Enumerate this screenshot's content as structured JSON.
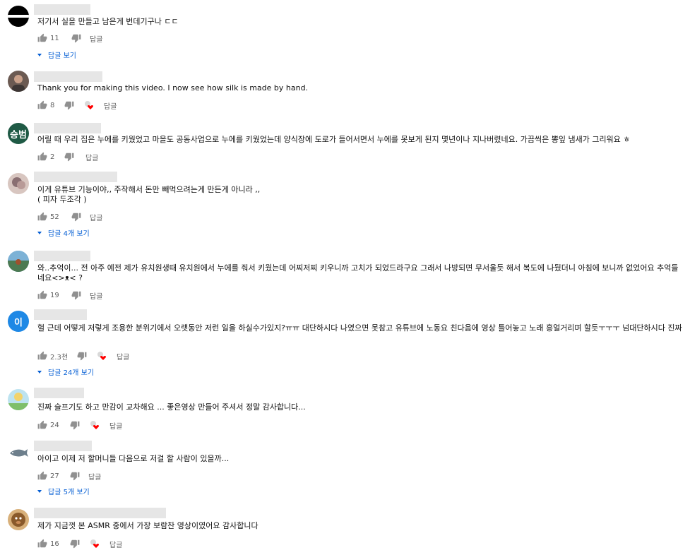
{
  "comments": [
    {
      "text": "저기서 실을 만들고 남은게 번데기구나 ㄷㄷ",
      "likes": "11",
      "reply_label": "답글",
      "replies_label": "답글 보기",
      "avatar_text": ""
    },
    {
      "text": "Thank you for making this video. I now see how silk is made by hand.",
      "likes": "8",
      "reply_label": "답글",
      "avatar_text": ""
    },
    {
      "text": "어릴 때 우리 집은 누에를 키웠었고 마을도 공동사업으로 누에를 키웠었는데 양식장에 도로가 들어서면서 누에를 못보게 된지 몇년이나 지나버렸네요. 가끔씩은 뽕잎 냄새가 그리워요 ㅎ",
      "likes": "2",
      "reply_label": "답글",
      "avatar_text": "승범"
    },
    {
      "text": "이게 유튜브 기능이야,, 주작해서 돈만 빼먹으려는게 만든게 아니라 ,,\n( 피자 두조각 )",
      "likes": "52",
      "reply_label": "답글",
      "replies_label": "답글 4개 보기",
      "avatar_text": ""
    },
    {
      "text": "와..추억이... 전 아주 예전 제가 유치원생때 유치원에서 누에를 줘서 키웠는데 어찌저찌 키우니까 고치가 되었드라구요 그래서 나방되면 무서울듯 해서 복도에 나뒀더니 아침에 보니까 없었어요 추억들네요<>ᴥ< ?",
      "likes": "19",
      "reply_label": "답글",
      "avatar_text": ""
    },
    {
      "text": "헐 근데 어떻게 저렇게 조용한 분위기에서 오랫동안 저런 일을 하실수가있지?ㅠㅠ 대단하시다 나였으면 못참고 유튜브에 노동요 친다음에 영상 틀어놓고 노래 흥얼거리며 할듯ㅜㅜㅜ 넘대단하시다 진짜",
      "likes": "2.3천",
      "reply_label": "답글",
      "replies_label": "답글 24개 보기",
      "avatar_text": "이"
    },
    {
      "text": "진짜 슬프기도 하고 만감이 교차해요 ... 좋은영상 만들어 주셔서 정말 감사합니다...",
      "likes": "24",
      "reply_label": "답글",
      "avatar_text": ""
    },
    {
      "text": "아이고 이제 저 할머니들 다음으로 저걸 할 사람이 있을까...",
      "likes": "27",
      "reply_label": "답글",
      "replies_label": "답글 5개 보기",
      "avatar_text": ""
    },
    {
      "text": "제가 지금껏 본 ASMR 중에서 가장 보람찬 영상이였어요 감사합니다",
      "likes": "16",
      "reply_label": "답글",
      "avatar_text": ""
    }
  ],
  "colors": {
    "reply_link": "#065fd4",
    "heart": "#ff0000",
    "secondary_text": "#606060",
    "name_placeholder": "#e6e6e6",
    "avatar_green": "#1f5a45",
    "avatar_blue": "#1e88e5"
  },
  "icons": [
    "like-icon",
    "dislike-icon",
    "creator-heart-icon",
    "expand-arrow-icon"
  ]
}
